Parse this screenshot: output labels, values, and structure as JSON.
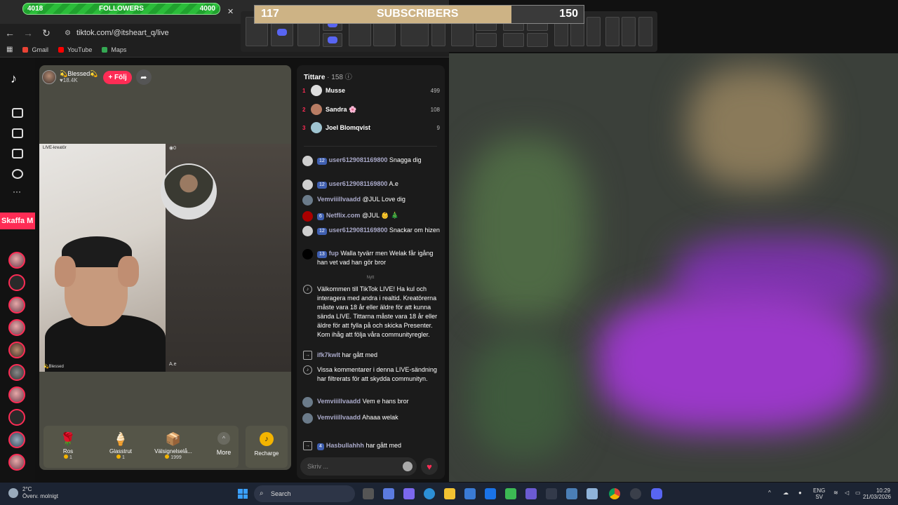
{
  "overlay": {
    "followers": {
      "label": "FOLLOWERS",
      "current": "4018",
      "goal": "4000",
      "progress": 1.0
    },
    "subscribers": {
      "label": "SUBSCRIBERS",
      "current": "117",
      "goal": "150",
      "progress": 0.78
    }
  },
  "browser": {
    "url": "tiktok.com/@itsheart_q/live",
    "bookmarks": [
      {
        "label": "Gmail",
        "color": "#ea4335"
      },
      {
        "label": "YouTube",
        "color": "#ff0000"
      },
      {
        "label": "Maps",
        "color": "#34a853"
      }
    ]
  },
  "sidebar": {
    "get_app_label": "Skaffa M"
  },
  "stream": {
    "host_name": "💫Blessed💫",
    "host_likes": "♥18.4K",
    "follow_label": "+ Följ",
    "live_tag": "LIVE-kreatör",
    "right_tag": "◉0",
    "ae_tag": "A.e",
    "blessed_tag": "💫Blessed"
  },
  "gifts": [
    {
      "name": "Ros",
      "price": "1",
      "icon": "🌹"
    },
    {
      "name": "Glasstrut",
      "price": "1",
      "icon": "🍦"
    },
    {
      "name": "Välsignelselå...",
      "price": "1999",
      "icon": "📦"
    }
  ],
  "more_label": "More",
  "recharge_label": "Recharge",
  "chat": {
    "title": "Tittare",
    "viewer_count": "· 158",
    "viewers": [
      {
        "rank": "1",
        "name": "Musse",
        "score": "499"
      },
      {
        "rank": "2",
        "name": "Sandra 🌸",
        "score": "108"
      },
      {
        "rank": "3",
        "name": "Joel Blomqvist",
        "score": "9"
      }
    ],
    "messages": [
      {
        "level": "12",
        "user": "user6129081169800",
        "text": "Snagga dig"
      },
      {
        "level": "12",
        "user": "user6129081169800",
        "text": "A.e"
      },
      {
        "level": "",
        "user": "Vemviiillvaadd",
        "text": "@JUL Love dig"
      },
      {
        "level": "6",
        "user": "Netflix.com",
        "text": "@JUL 👶 🎄"
      },
      {
        "level": "12",
        "user": "user6129081169800",
        "text": "Snackar om hizen"
      },
      {
        "level": "13",
        "user": "fup",
        "text": "Walla tyvärr men Welak får igång han vet vad han gör bror"
      }
    ],
    "new_label": "Nytt",
    "system_welcome": "Välkommen till TikTok LIVE! Ha kul och interagera med andra i realtid. Kreatörerna måste vara 18 år eller äldre för att kunna sända LIVE. Tittarna måste vara 18 år eller äldre för att fylla på och skicka Presenter. Kom ihåg att följa våra communityregler.",
    "join1_user": "ifk7kwlt",
    "join1_text": "har gått med",
    "system_filter": "Vissa kommentarer i denna LIVE-sändning har filtrerats för att skydda communityn.",
    "msg7_user": "Vemviiillvaadd",
    "msg7_text": "Vem e hans bror",
    "msg8_user": "Vemviiillvaadd",
    "msg8_text": "Ahaaa welak",
    "join2_level": "4",
    "join2_user": "Hasbullahhh",
    "join2_text": "har gått med",
    "input_placeholder": "Skriv ..."
  },
  "taskbar": {
    "temperature": "2°C",
    "weather": "Överv. molnigt",
    "search_label": "Search",
    "lang": "ENG",
    "region": "SV",
    "time": "10:29",
    "date": "21/03/2026"
  }
}
